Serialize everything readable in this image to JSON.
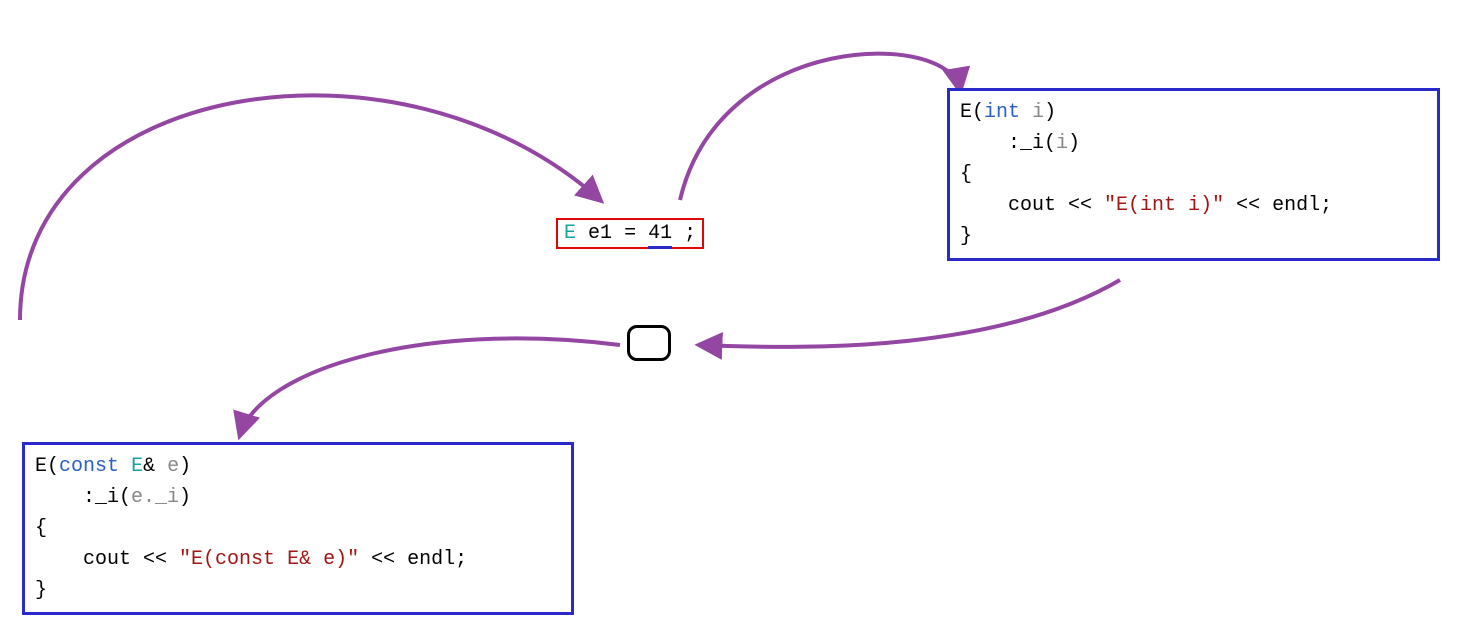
{
  "diagram": {
    "arrow_color": "#9446a3",
    "center_statement": {
      "tokens": {
        "class": "E",
        "ident": "e1",
        "equals": "=",
        "value": "41",
        "semicolon": ";"
      }
    },
    "constructor_int": {
      "line1": {
        "class": "E",
        "lparen": "(",
        "type": "int",
        "space": " ",
        "param": "i",
        "rparen": ")"
      },
      "line2": {
        "init": ":_i(",
        "arg": "i",
        "close": ")"
      },
      "line3": "{",
      "line4": {
        "indent": "    ",
        "cout": "cout",
        "op1": " << ",
        "str": "\"E(int i)\"",
        "op2": " << ",
        "endl": "endl",
        "semi": ";"
      },
      "line5": "}"
    },
    "constructor_copy": {
      "line1": {
        "class": "E",
        "lparen": "(",
        "kw": "const",
        "space1": " ",
        "ptype": "E",
        "amp": "&",
        "space2": " ",
        "param": "e",
        "rparen": ")"
      },
      "line2": {
        "init": ":_i(",
        "arg": "e._i",
        "close": ")"
      },
      "line3": "{",
      "line4": {
        "indent": "    ",
        "cout": "cout",
        "op1": " << ",
        "str": "\"E(const E& e)\"",
        "op2": " << ",
        "endl": "endl",
        "semi": ";"
      },
      "line5": "}"
    }
  }
}
